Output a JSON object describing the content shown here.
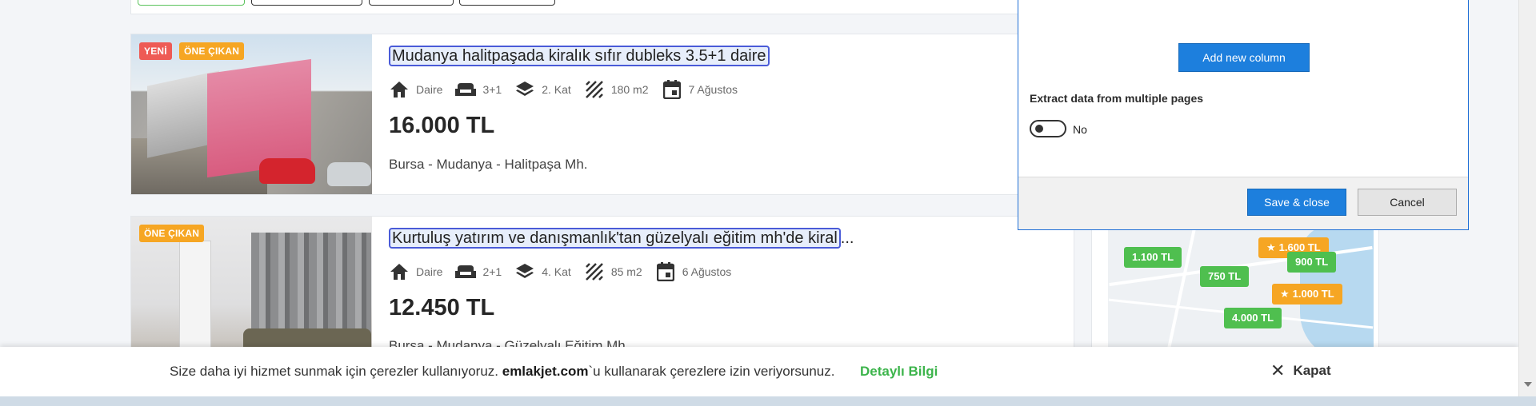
{
  "listings": [
    {
      "badges": [
        "YENİ",
        "ÖNE ÇIKAN"
      ],
      "title": "Mudanya halitpaşada kiralık sıfır dubleks 3.5+1 daire",
      "title_suffix": "",
      "type": "Daire",
      "rooms": "3+1",
      "floor": "2. Kat",
      "area": "180 m2",
      "date": "7 Ağustos",
      "price": "16.000 TL",
      "location": "Bursa - Mudanya - Halitpaşa Mh."
    },
    {
      "badges": [
        "ÖNE ÇIKAN"
      ],
      "title": "Kurtuluş yatırım ve danışmanlık'tan güzelyalı eğitim mh'de kiral",
      "title_suffix": "...",
      "type": "Daire",
      "rooms": "2+1",
      "floor": "4. Kat",
      "area": "85 m2",
      "date": "6 Ağustos",
      "price": "12.450 TL",
      "location": "Bursa - Mudanya - Güzelyalı Eğitim Mh."
    }
  ],
  "map": {
    "pins": [
      {
        "label": "1.100 TL",
        "color": "green",
        "star": false
      },
      {
        "label": "1.600 TL",
        "color": "orange",
        "star": true
      },
      {
        "label": "900 TL",
        "color": "green",
        "star": false
      },
      {
        "label": "750 TL",
        "color": "green",
        "star": false
      },
      {
        "label": "1.000 TL",
        "color": "orange",
        "star": true
      },
      {
        "label": "4.000 TL",
        "color": "green",
        "star": false
      }
    ]
  },
  "dialog": {
    "add_column_label": "Add new column",
    "extract_label": "Extract data from multiple pages",
    "toggle_state": "No",
    "save_label": "Save & close",
    "cancel_label": "Cancel"
  },
  "cookie": {
    "text_before": "Size daha iyi hizmet sunmak için çerezler kullanıyoruz. ",
    "brand": "emlakjet.com",
    "text_after": "`u kullanarak çerezlere izin veriyorsunuz.",
    "link_label": "Detaylı Bilgi",
    "close_label": "Kapat"
  },
  "colors": {
    "accent_blue": "#1d7fdd",
    "badge_red": "#ee5b55",
    "badge_orange": "#f6a623",
    "pin_green": "#4fbf4f",
    "link_green": "#3cb44b"
  }
}
